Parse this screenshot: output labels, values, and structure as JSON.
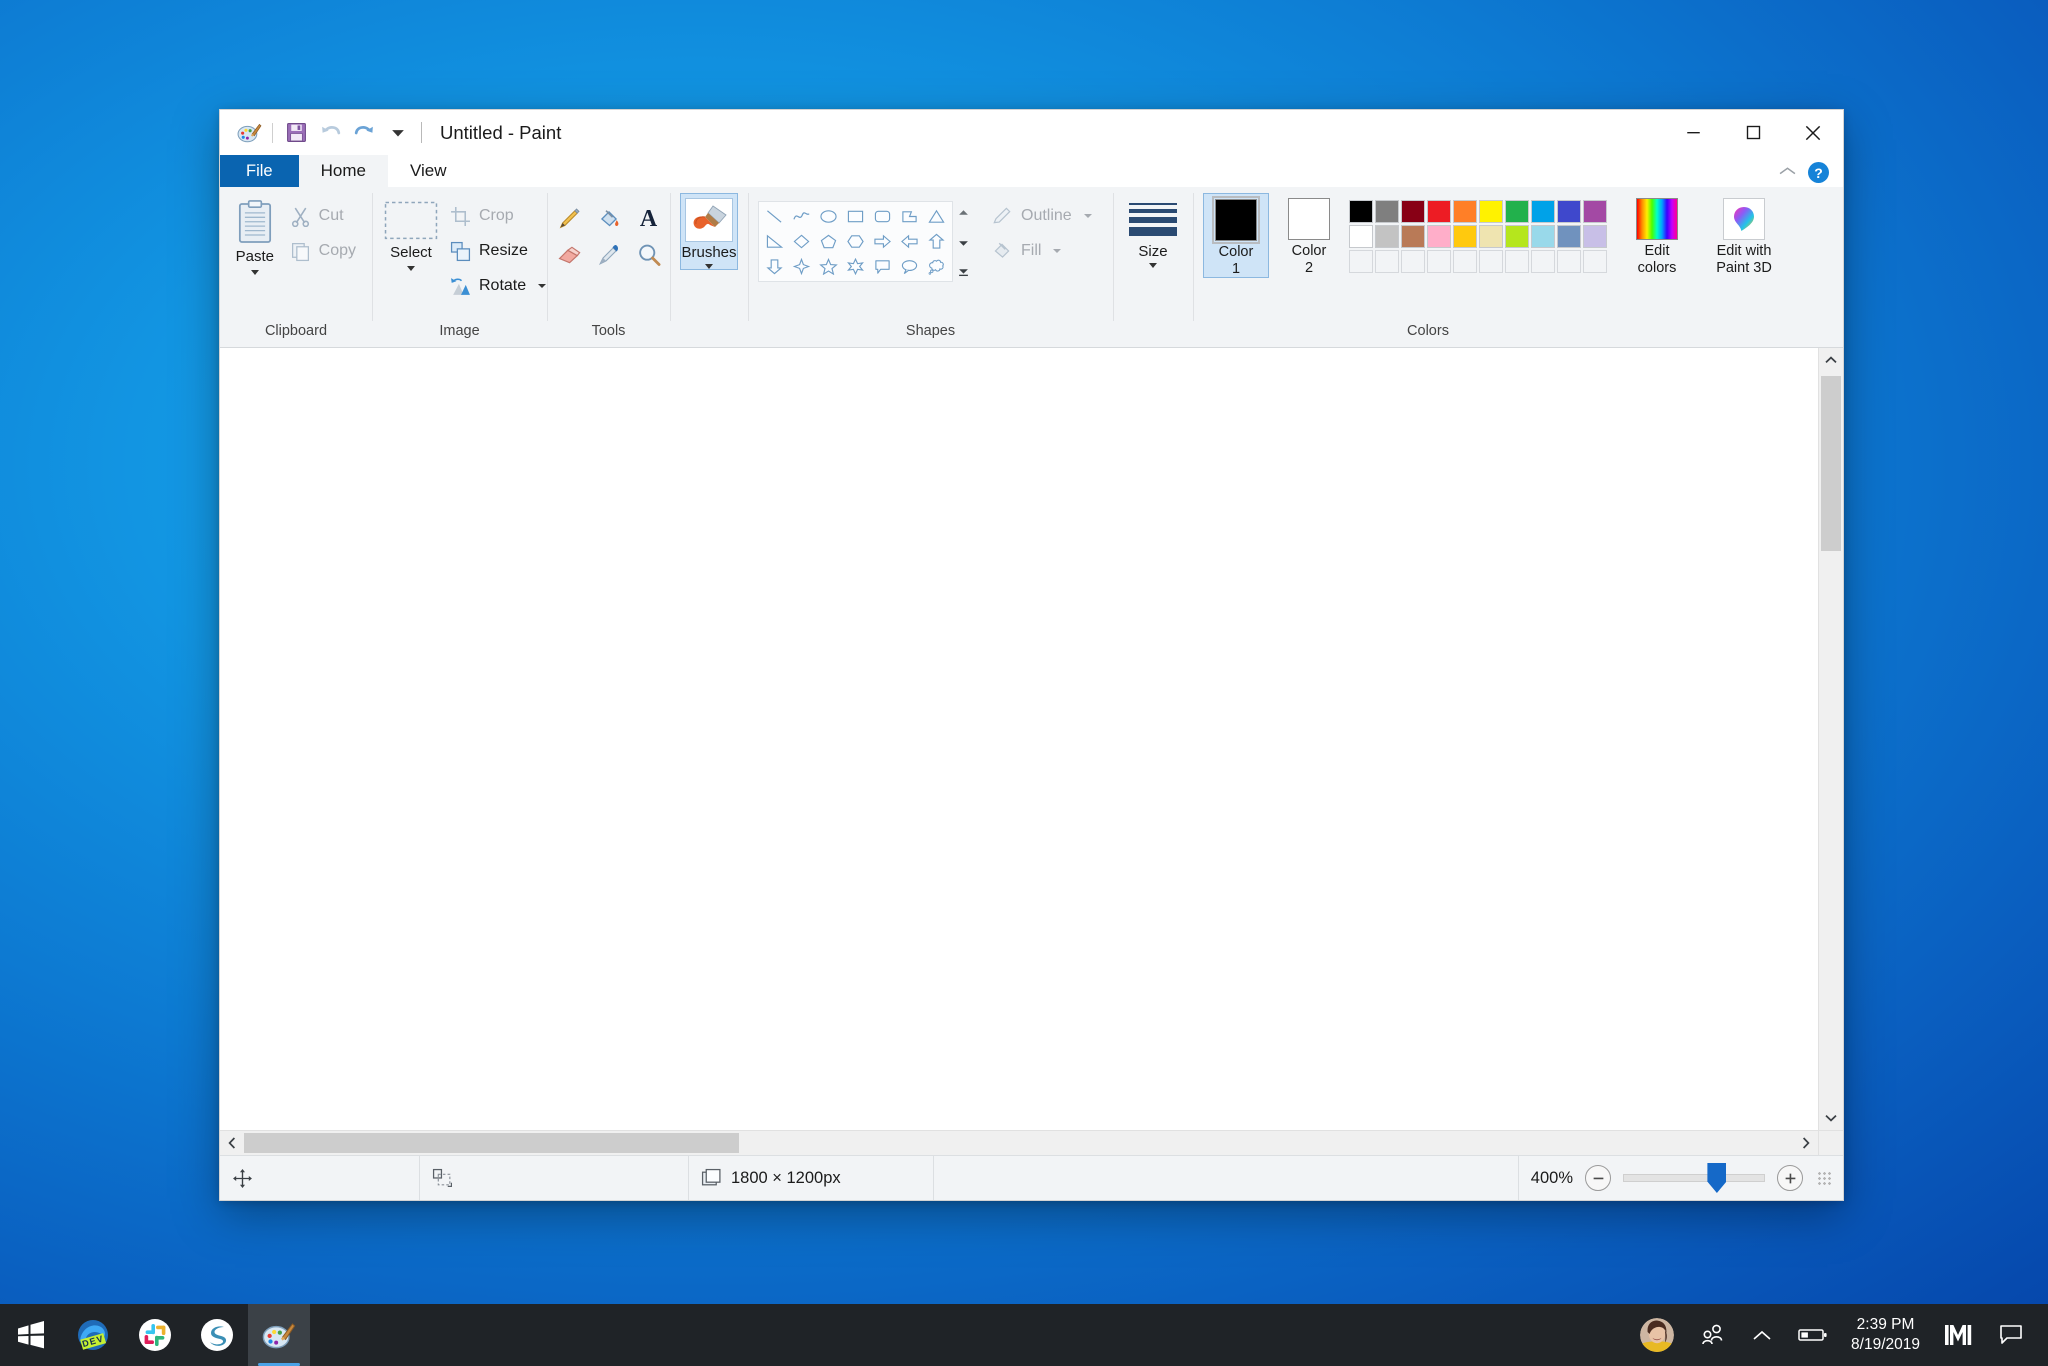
{
  "window": {
    "title": "Untitled - Paint",
    "quick_access": [
      {
        "name": "paint-app-icon",
        "label": "Paint"
      },
      {
        "name": "save-icon",
        "label": "Save"
      },
      {
        "name": "undo-icon",
        "label": "Undo"
      },
      {
        "name": "redo-icon",
        "label": "Redo"
      },
      {
        "name": "customize-quick-access-icon",
        "label": "Customize Quick Access Toolbar"
      }
    ],
    "controls": {
      "minimize": "—",
      "maximize": "□",
      "close": "✕"
    },
    "ribbon_collapse": "Minimize the Ribbon",
    "help": "?"
  },
  "tabs": [
    {
      "label": "File",
      "state": "file"
    },
    {
      "label": "Home",
      "state": "active"
    },
    {
      "label": "View",
      "state": "normal"
    }
  ],
  "ribbon": {
    "clipboard": {
      "group_label": "Clipboard",
      "paste": {
        "label": "Paste",
        "enabled": true
      },
      "cut": {
        "label": "Cut",
        "enabled": false
      },
      "copy": {
        "label": "Copy",
        "enabled": false
      }
    },
    "image": {
      "group_label": "Image",
      "select": {
        "label": "Select",
        "enabled": true
      },
      "crop": {
        "label": "Crop",
        "enabled": false
      },
      "resize": {
        "label": "Resize",
        "enabled": true
      },
      "rotate": {
        "label": "Rotate",
        "enabled": true
      }
    },
    "tools": {
      "group_label": "Tools",
      "items": [
        {
          "name": "pencil-tool",
          "label": "Pencil"
        },
        {
          "name": "fill-with-color-tool",
          "label": "Fill with color"
        },
        {
          "name": "text-tool",
          "label": "Text"
        },
        {
          "name": "eraser-tool",
          "label": "Eraser"
        },
        {
          "name": "color-picker-tool",
          "label": "Color picker"
        },
        {
          "name": "magnifier-tool",
          "label": "Magnifier"
        }
      ]
    },
    "brushes": {
      "label": "Brushes",
      "selected": true
    },
    "shapes": {
      "group_label": "Shapes",
      "items": [
        {
          "name": "line-shape",
          "label": "Line"
        },
        {
          "name": "curve-shape",
          "label": "Curve"
        },
        {
          "name": "oval-shape",
          "label": "Oval"
        },
        {
          "name": "rectangle-shape",
          "label": "Rectangle"
        },
        {
          "name": "rounded-rectangle-shape",
          "label": "Rounded rectangle"
        },
        {
          "name": "polygon-shape",
          "label": "Polygon"
        },
        {
          "name": "triangle-shape",
          "label": "Triangle"
        },
        {
          "name": "right-triangle-shape",
          "label": "Right triangle"
        },
        {
          "name": "diamond-shape",
          "label": "Diamond"
        },
        {
          "name": "pentagon-shape",
          "label": "Pentagon"
        },
        {
          "name": "hexagon-shape",
          "label": "Hexagon"
        },
        {
          "name": "right-arrow-shape",
          "label": "Right arrow"
        },
        {
          "name": "left-arrow-shape",
          "label": "Left arrow"
        },
        {
          "name": "up-arrow-shape",
          "label": "Up arrow"
        },
        {
          "name": "down-arrow-shape",
          "label": "Down arrow"
        },
        {
          "name": "four-point-star-shape",
          "label": "Four-point star"
        },
        {
          "name": "five-point-star-shape",
          "label": "Five-point star"
        },
        {
          "name": "six-point-star-shape",
          "label": "Six-point star"
        },
        {
          "name": "rounded-rectangular-callout-shape",
          "label": "Rounded rectangular callout"
        },
        {
          "name": "oval-callout-shape",
          "label": "Oval callout"
        },
        {
          "name": "cloud-callout-shape",
          "label": "Cloud callout"
        }
      ],
      "outline": {
        "label": "Outline",
        "enabled": false
      },
      "fill": {
        "label": "Fill",
        "enabled": false
      }
    },
    "size": {
      "label": "Size"
    },
    "colors": {
      "group_label": "Colors",
      "color1": {
        "label_line1": "Color",
        "label_line2": "1",
        "value": "#000000",
        "selected": true
      },
      "color2": {
        "label_line1": "Color",
        "label_line2": "2",
        "value": "#ffffff",
        "selected": false
      },
      "palette_row1": [
        "#000000",
        "#7f7f7f",
        "#880015",
        "#ed1c24",
        "#ff7f27",
        "#fff200",
        "#22b14c",
        "#00a2e8",
        "#3f48cc",
        "#a349a4"
      ],
      "palette_row2": [
        "#ffffff",
        "#c3c3c3",
        "#b97a57",
        "#ffaec9",
        "#ffc90e",
        "#efe4b0",
        "#b5e61d",
        "#99d9ea",
        "#7092be",
        "#c8bfe7"
      ],
      "palette_row3": [
        "",
        "",
        "",
        "",
        "",
        "",
        "",
        "",
        "",
        ""
      ],
      "edit_colors": {
        "line1": "Edit",
        "line2": "colors"
      },
      "edit_with_paint3d": {
        "line1": "Edit with",
        "line2": "Paint 3D"
      }
    }
  },
  "status_bar": {
    "cursor_position": "",
    "selection_size": "",
    "image_size": "1800 × 1200px",
    "zoom_level": "400%",
    "zoom_out": "−",
    "zoom_in": "+",
    "zoom_slider_percent": 66
  },
  "taskbar": {
    "apps": [
      {
        "name": "start-button",
        "label": "Start",
        "active": false,
        "running": false
      },
      {
        "name": "taskbar-item-edge-dev",
        "label": "Microsoft Edge Dev",
        "active": false,
        "running": true
      },
      {
        "name": "taskbar-item-slack",
        "label": "Slack",
        "active": false,
        "running": true
      },
      {
        "name": "taskbar-item-smartgit",
        "label": "SmartGit",
        "active": false,
        "running": true
      },
      {
        "name": "taskbar-item-paint",
        "label": "Paint",
        "active": true,
        "running": true
      }
    ],
    "tray": {
      "account_avatar": "User account",
      "people_icon": "People",
      "show_hidden_icons": "Show hidden icons",
      "battery_icon": "Battery",
      "time": "2:39 PM",
      "date": "8/19/2019",
      "m_icon": "Microsoft Teams",
      "action_center_icon": "Action Center"
    }
  }
}
